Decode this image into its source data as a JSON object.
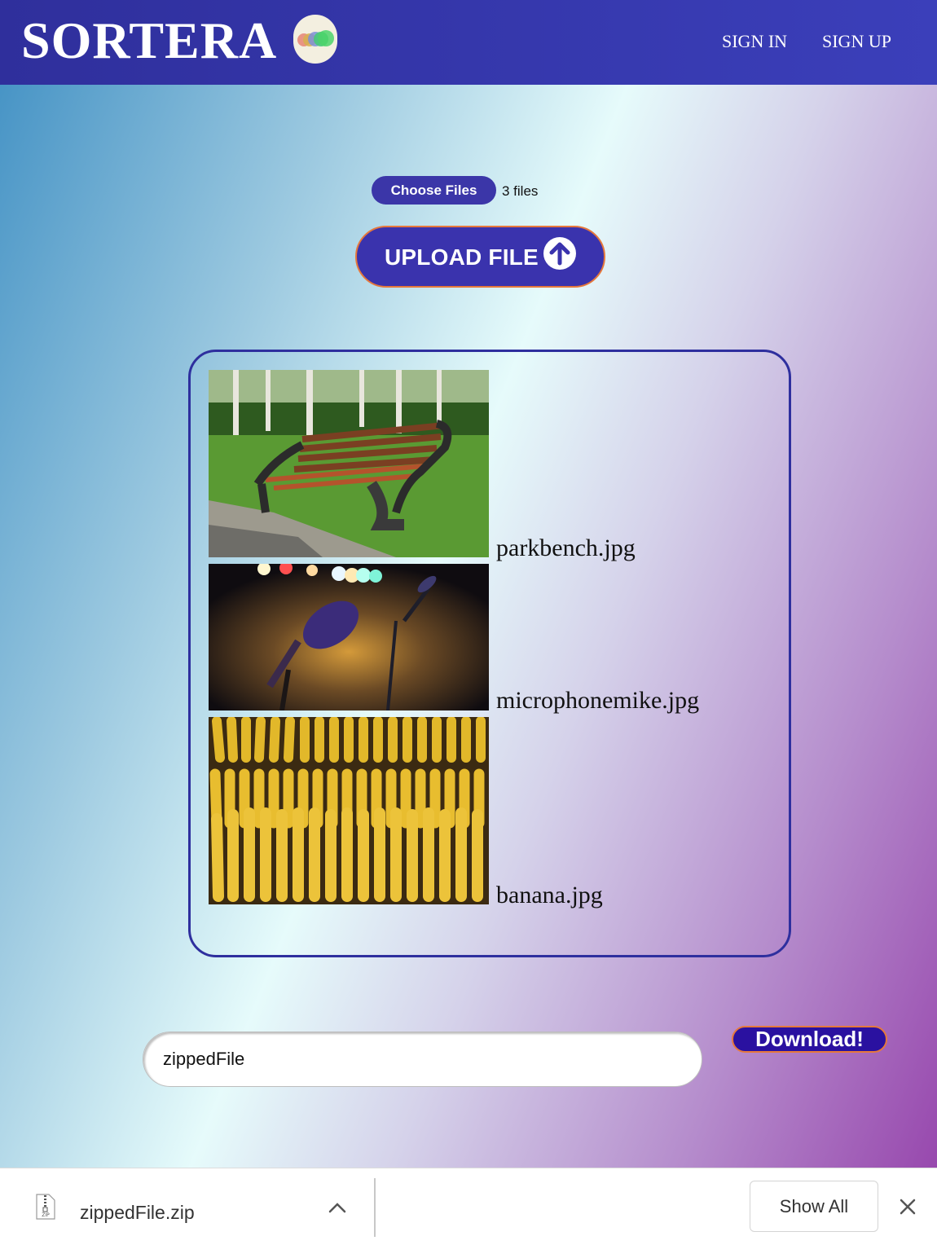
{
  "header": {
    "logo": "SORTERA",
    "nav": {
      "sign_in": "SIGN IN",
      "sign_up": "SIGN UP"
    }
  },
  "upload": {
    "choose_label": "Choose Files",
    "file_count": "3 files",
    "upload_label": "UPLOAD FILE"
  },
  "files": [
    {
      "name": "parkbench.jpg"
    },
    {
      "name": "microphonemike.jpg"
    },
    {
      "name": "banana.jpg"
    }
  ],
  "download": {
    "zip_name": "zippedFile",
    "button_label": "Download!"
  },
  "shelf": {
    "filename": "zippedFile.zip",
    "icon_label": "ZIP",
    "show_all": "Show All"
  },
  "colors": {
    "header": "#3b3fba",
    "accent": "#3a33ad",
    "button_border": "#e6783c",
    "box_border": "#2e2f9e"
  }
}
